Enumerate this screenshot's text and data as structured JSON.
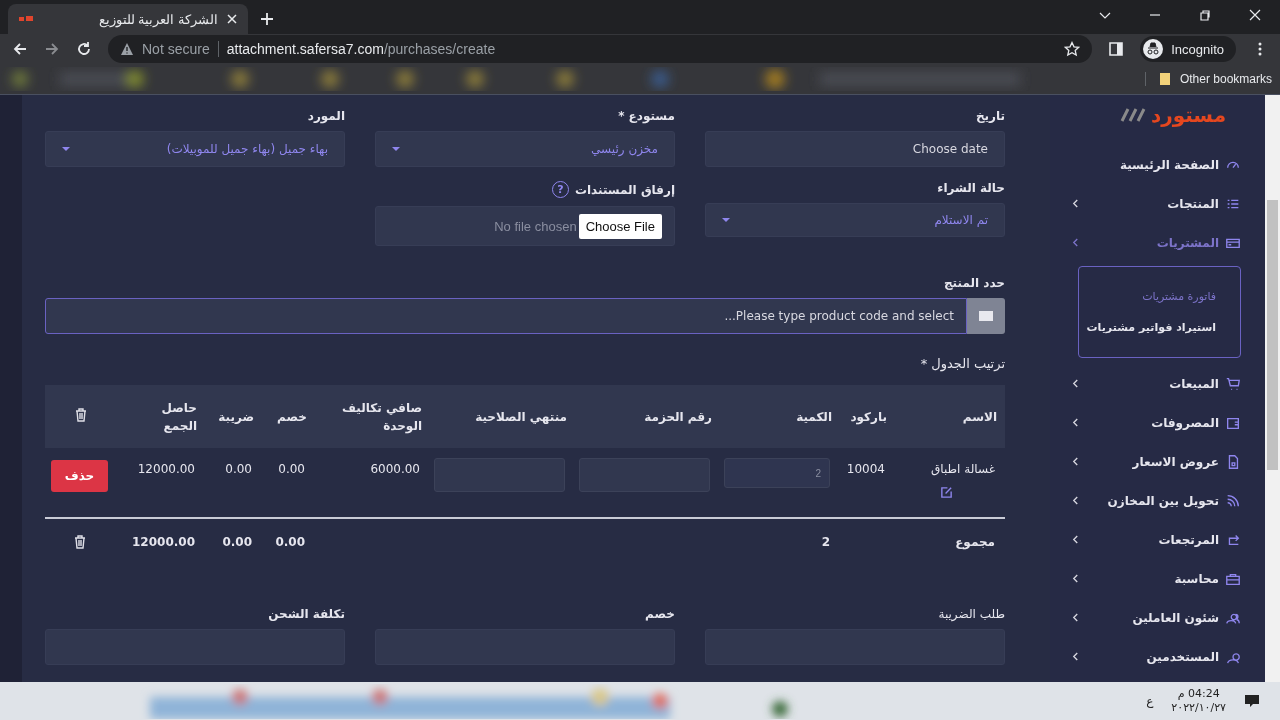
{
  "browser": {
    "tab_title": "الشركة العربية للتوزيع",
    "security": "Not secure",
    "url_host": "attachment.safersa7.com",
    "url_path": "/purchases/create",
    "profile": "Incognito",
    "bookmarks_folder": "Other bookmarks"
  },
  "sidebar": {
    "logo": "مستورد",
    "items": [
      {
        "label": "الصفحة الرئيسية",
        "expandable": false,
        "selected": false
      },
      {
        "label": "المنتجات",
        "expandable": true,
        "selected": false
      },
      {
        "label": "المشتريات",
        "expandable": true,
        "selected": true,
        "expanded": true,
        "children": [
          {
            "label": "فاتورة مشتريات",
            "selected": true
          },
          {
            "label": "استيراد فواتير مشتريات",
            "selected": false
          }
        ]
      },
      {
        "label": "المبيعات",
        "expandable": true,
        "selected": false
      },
      {
        "label": "المصروفات",
        "expandable": true,
        "selected": false
      },
      {
        "label": "عروض الاسعار",
        "expandable": true,
        "selected": false
      },
      {
        "label": "تحويل بين المخازن",
        "expandable": true,
        "selected": false
      },
      {
        "label": "المرتجعات",
        "expandable": true,
        "selected": false
      },
      {
        "label": "محاسبة",
        "expandable": true,
        "selected": false
      },
      {
        "label": "شئون العاملين",
        "expandable": true,
        "selected": false
      },
      {
        "label": "المستخدمين",
        "expandable": true,
        "selected": false
      }
    ]
  },
  "form": {
    "date": {
      "label": "تاريخ",
      "placeholder": "Choose date"
    },
    "warehouse": {
      "label": "مستودع *",
      "value": "مخزن رئيسي"
    },
    "supplier": {
      "label": "المورد",
      "value": "بهاء جميل (بهاء جميل للموبيلات)"
    },
    "status": {
      "label": "حالة الشراء",
      "value": "تم الاستلام"
    },
    "attachment": {
      "label": "إرفاق المستندات",
      "help": "?",
      "button": "Choose File",
      "file": "No file chosen"
    },
    "product": {
      "label": "حدد المنتج",
      "placeholder": "Please type product code and select..."
    }
  },
  "table": {
    "label": "ترتيب الجدول *",
    "columns": [
      "الاسم",
      "باركود",
      "الكمية",
      "رقم الحزمة",
      "منتهي الصلاحية",
      "صافي تكاليف الوحدة",
      "خصم",
      "ضريبة",
      "حاصل الجمع"
    ],
    "rows": [
      {
        "name": "غسالة اطباق",
        "barcode": "10004",
        "quantity": "2",
        "unit_cost": "6000.00",
        "discount": "0.00",
        "tax": "0.00",
        "total": "12000.00",
        "delete": "حذف"
      }
    ],
    "totals": {
      "label": "مجموع",
      "quantity": "2",
      "discount": "0.00",
      "tax": "0.00",
      "total": "12000.00"
    }
  },
  "bottom_labels": [
    "طلب الضريبة",
    "خصم",
    "تكلفة الشحن"
  ],
  "taskbar": {
    "language": "ع",
    "time": "04:24 م",
    "date": "٢٠٢٢/١٠/٢٧"
  }
}
